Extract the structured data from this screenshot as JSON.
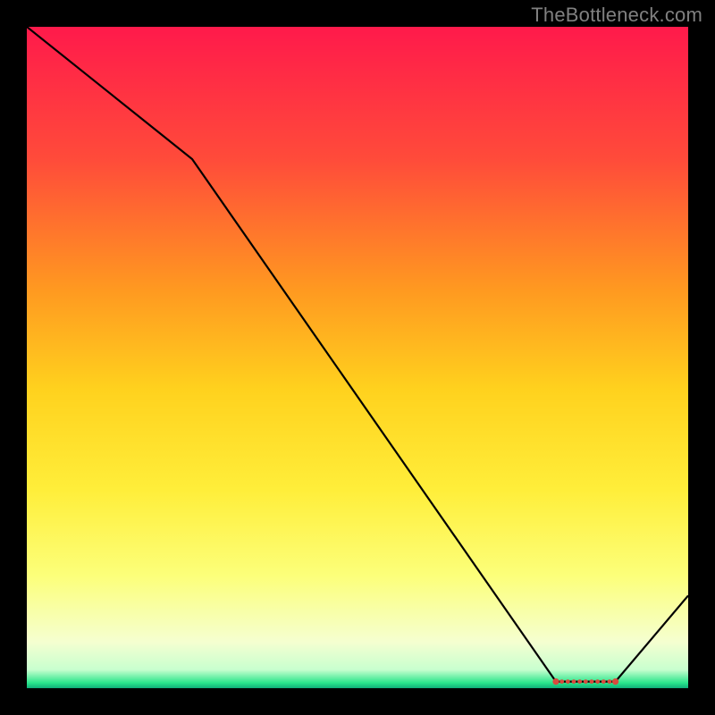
{
  "attribution": "TheBottleneck.com",
  "chart_data": {
    "type": "line",
    "title": "",
    "xlabel": "",
    "ylabel": "",
    "xlim": [
      0,
      100
    ],
    "ylim": [
      0,
      100
    ],
    "grid": false,
    "series": [
      {
        "name": "curve",
        "x": [
          0,
          25,
          80,
          89,
          100
        ],
        "y": [
          100,
          80,
          1,
          1,
          14
        ]
      }
    ],
    "markers": {
      "name": "dots",
      "x": [
        80.0,
        80.9,
        81.8,
        82.7,
        83.6,
        84.5,
        85.4,
        86.3,
        87.2,
        88.1,
        89.0
      ],
      "y": [
        1,
        1,
        1,
        1,
        1,
        1,
        1,
        1,
        1,
        1,
        1
      ]
    },
    "background_gradient": {
      "stops": [
        {
          "offset": 0.0,
          "color": "#ff1a4b"
        },
        {
          "offset": 0.2,
          "color": "#ff4b3a"
        },
        {
          "offset": 0.4,
          "color": "#ff9a20"
        },
        {
          "offset": 0.55,
          "color": "#ffd21e"
        },
        {
          "offset": 0.7,
          "color": "#ffee3a"
        },
        {
          "offset": 0.83,
          "color": "#fcff7a"
        },
        {
          "offset": 0.93,
          "color": "#f5ffd0"
        },
        {
          "offset": 0.972,
          "color": "#c8ffcf"
        },
        {
          "offset": 0.992,
          "color": "#29e58b"
        },
        {
          "offset": 1.0,
          "color": "#0fae78"
        }
      ]
    }
  }
}
